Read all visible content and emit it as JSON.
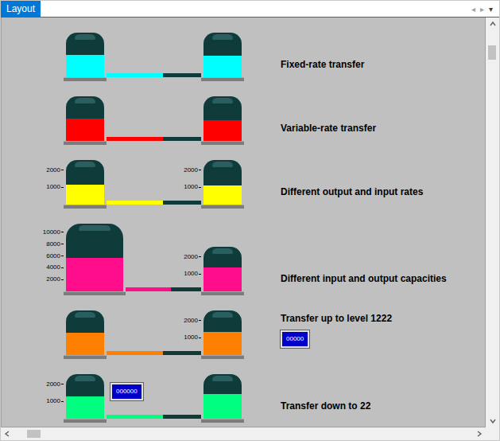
{
  "window": {
    "title": "Layout",
    "controls": [
      "◂",
      "▸",
      "▾"
    ]
  },
  "rows": [
    {
      "label": "Fixed-rate transfer",
      "color": "#00ffff",
      "pipe": {
        "level": 0.6
      },
      "source": {
        "kind": "standard",
        "level": 0.5,
        "ticks": []
      },
      "target": {
        "kind": "standard",
        "level": 0.48,
        "ticks": []
      },
      "readout": null
    },
    {
      "label": "Variable-rate transfer",
      "color": "#ff0000",
      "pipe": {
        "level": 0.6
      },
      "source": {
        "kind": "standard",
        "level": 0.5,
        "ticks": []
      },
      "target": {
        "kind": "standard",
        "level": 0.47,
        "ticks": []
      },
      "readout": null
    },
    {
      "label": "Different output and input rates",
      "color": "#ffff00",
      "pipe": {
        "level": 0.6
      },
      "source": {
        "kind": "standard",
        "level": 0.45,
        "ticks": [
          "2000",
          "1000"
        ]
      },
      "target": {
        "kind": "standard",
        "level": 0.43,
        "ticks": [
          "2000",
          "1000"
        ]
      },
      "readout": null
    },
    {
      "label": "Different input and output capacities",
      "color": "#ff0d8a",
      "pipe": {
        "level": 0.6
      },
      "source": {
        "kind": "large",
        "level": 0.5,
        "ticks": [
          "10000",
          "8000",
          "6000",
          "4000",
          "2000"
        ]
      },
      "target": {
        "kind": "standard",
        "level": 0.53,
        "ticks": [
          "2000",
          "1000"
        ]
      },
      "readout": null
    },
    {
      "label": "Transfer up to level 1222",
      "color": "#ff8000",
      "pipe": {
        "level": 0.6
      },
      "source": {
        "kind": "standard",
        "level": 0.5,
        "ticks": []
      },
      "target": {
        "kind": "standard",
        "level": 0.52,
        "ticks": [
          "2000",
          "1000"
        ]
      },
      "readout": {
        "text": "00000",
        "attached": "label"
      }
    },
    {
      "label": "Transfer down to 22",
      "color": "#00ff80",
      "pipe": {
        "level": 0.6
      },
      "source": {
        "kind": "standard",
        "level": 0.5,
        "ticks": [
          "2000",
          "1000"
        ]
      },
      "target": {
        "kind": "standard",
        "level": 0.55,
        "ticks": []
      },
      "readout": {
        "text": "000000",
        "attached": "source"
      }
    }
  ],
  "scrollbars": {
    "vertical": {
      "level": 0.04
    },
    "horizontal": {
      "level": 0.03
    }
  }
}
